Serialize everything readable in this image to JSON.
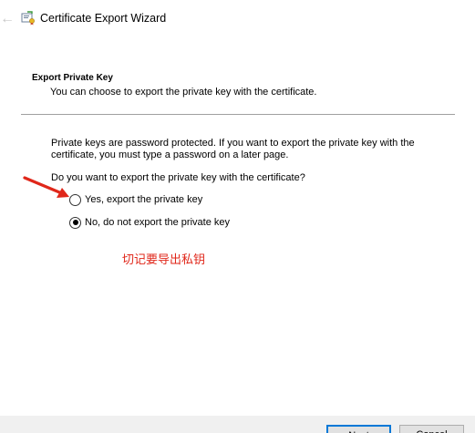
{
  "window": {
    "title": "Certificate Export Wizard",
    "back_icon": "back-arrow-icon",
    "app_icon": "certificate-icon"
  },
  "header": {
    "title": "Export Private Key",
    "subtitle": "You can choose to export the private key with the certificate."
  },
  "content": {
    "description": "Private keys are password protected. If you want to export the private key with the certificate, you must type a password on a later page.",
    "question": "Do you want to export the private key with the certificate?",
    "options": [
      {
        "label": "Yes, export the private key",
        "selected": false
      },
      {
        "label": "No, do not export the private key",
        "selected": true
      }
    ]
  },
  "annotation": {
    "note": "切记要导出私钥",
    "color": "#e0271a"
  },
  "footer": {
    "next_label": "Next",
    "cancel_label": "Cancel"
  },
  "colors": {
    "accent": "#0078d7",
    "divider": "#a0a0a0",
    "footer_bg": "#f0f0f0"
  }
}
